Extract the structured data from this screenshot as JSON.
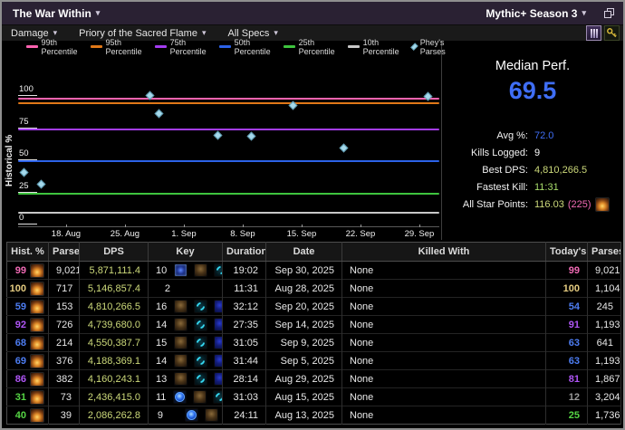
{
  "titlebar": {
    "expansion": "The War Within",
    "season": "Mythic+ Season 3",
    "caret": "▾"
  },
  "toolbar": {
    "metric": "Damage",
    "boss": "Priory of the Sacred Flame",
    "spec": "All Specs",
    "caret": "▾"
  },
  "icons": {
    "titlebar_window": "copy-window-icon",
    "boss_tile": "boss-icon",
    "key_tile": "key-icon",
    "parses_marker": "diamond-icon",
    "player_spec": "spec-icon"
  },
  "legend": [
    {
      "label": "99th Percentile",
      "color": "#ff63b0",
      "type": "line"
    },
    {
      "label": "95th Percentile",
      "color": "#e07818",
      "type": "line"
    },
    {
      "label": "75th Percentile",
      "color": "#a43cf0",
      "type": "line"
    },
    {
      "label": "50th Percentile",
      "color": "#2c62e8",
      "type": "line"
    },
    {
      "label": "25th Percentile",
      "color": "#3ec43e",
      "type": "line"
    },
    {
      "label": "10th Percentile",
      "color": "#c8c8c8",
      "type": "line"
    },
    {
      "label": "Phey's Parses",
      "color": "#a5d9eb",
      "type": "diamond"
    }
  ],
  "chart_data": {
    "type": "scatter",
    "title": "",
    "xlabel": "",
    "ylabel": "Historical %",
    "ylim": [
      0,
      130
    ],
    "grid": false,
    "yticks": [
      100,
      75,
      50,
      25,
      0
    ],
    "x_ticks": [
      {
        "label": "18. Aug",
        "day": 7
      },
      {
        "label": "25. Aug",
        "day": 14
      },
      {
        "label": "1. Sep",
        "day": 21
      },
      {
        "label": "8. Sep",
        "day": 28
      },
      {
        "label": "15. Sep",
        "day": 35
      },
      {
        "label": "22. Sep",
        "day": 42
      },
      {
        "label": "29. Sep",
        "day": 49
      }
    ],
    "percentile_lines": [
      {
        "name": "99th Percentile",
        "value": 99,
        "color": "#ff63b0"
      },
      {
        "name": "95th Percentile",
        "value": 95,
        "color": "#e07818"
      },
      {
        "name": "75th Percentile",
        "value": 75,
        "color": "#a43cf0"
      },
      {
        "name": "50th Percentile",
        "value": 50,
        "color": "#2c62e8"
      },
      {
        "name": "25th Percentile",
        "value": 25,
        "color": "#3ec43e"
      },
      {
        "name": "10th Percentile",
        "value": 10,
        "color": "#c8c8c8"
      }
    ],
    "series_name": "Phey's Parses",
    "point_color": "#a5d9eb",
    "points": [
      {
        "date": "Aug 13, 2025",
        "day": 2,
        "value": 40
      },
      {
        "date": "Aug 15, 2025",
        "day": 4,
        "value": 31
      },
      {
        "date": "Aug 28, 2025",
        "day": 17,
        "value": 100
      },
      {
        "date": "Aug 29, 2025",
        "day": 18,
        "value": 86
      },
      {
        "date": "Sep 5, 2025",
        "day": 25,
        "value": 69
      },
      {
        "date": "Sep 9, 2025",
        "day": 29,
        "value": 68
      },
      {
        "date": "Sep 14, 2025",
        "day": 34,
        "value": 92
      },
      {
        "date": "Sep 20, 2025",
        "day": 40,
        "value": 59
      },
      {
        "date": "Sep 30, 2025",
        "day": 50,
        "value": 99
      }
    ]
  },
  "summary": {
    "median_label": "Median Perf.",
    "median_value": "69.5",
    "median_color": "#3f6ef5",
    "stats": [
      {
        "label": "Avg %:",
        "value": "72.0",
        "color": "#3f6ef5"
      },
      {
        "label": "Kills Logged:",
        "value": "9",
        "color": "#ffffff"
      },
      {
        "label": "Best DPS:",
        "value": "4,810,266.5",
        "color": "#ccd97a"
      },
      {
        "label": "Fastest Kill:",
        "value": "11:31",
        "color": "#a8dd6b"
      },
      {
        "label": "All Star Points:",
        "value": "116.03",
        "color": "#ccd97a",
        "extra": "(225)",
        "extra_color": "#f06ab4",
        "icon": "spec-icon"
      }
    ]
  },
  "table": {
    "headers": [
      "Hist. %",
      "Parses",
      "DPS",
      "Key",
      "Duration",
      "Date",
      "Killed With",
      "Today's %",
      "Parses"
    ],
    "dps_color": "#ccd97a",
    "tier_colors": {
      "artifact": "#e5cc80",
      "astounding": "#f06ab4",
      "epic": "#af55f5",
      "rare": "#4d7df2",
      "uncommon": "#55d544",
      "common": "#9a9a9a"
    },
    "rows": [
      {
        "hist": "99",
        "hist_tier": "astounding",
        "parses": "9,021",
        "dps": "5,871,111.4",
        "key": "10",
        "affixes": [
          "ascendant",
          "devour",
          "swirl"
        ],
        "duration": "19:02",
        "date": "Sep 30, 2025",
        "killed_with": "None",
        "today": "99",
        "today_tier": "astounding",
        "today_parses": "9,021"
      },
      {
        "hist": "100",
        "hist_tier": "artifact",
        "parses": "717",
        "dps": "5,146,857.4",
        "key": "2",
        "affixes": [],
        "duration": "11:31",
        "date": "Aug 28, 2025",
        "killed_with": "None",
        "today": "100",
        "today_tier": "artifact",
        "today_parses": "1,104"
      },
      {
        "hist": "59",
        "hist_tier": "rare",
        "parses": "153",
        "dps": "4,810,266.5",
        "key": "16",
        "affixes": [
          "devour",
          "swirl",
          "voidbound"
        ],
        "duration": "32:12",
        "date": "Sep 20, 2025",
        "killed_with": "None",
        "today": "54",
        "today_tier": "rare",
        "today_parses": "245"
      },
      {
        "hist": "92",
        "hist_tier": "epic",
        "parses": "726",
        "dps": "4,739,680.0",
        "key": "14",
        "affixes": [
          "devour",
          "swirl",
          "voidbound"
        ],
        "duration": "27:35",
        "date": "Sep 14, 2025",
        "killed_with": "None",
        "today": "91",
        "today_tier": "epic",
        "today_parses": "1,193"
      },
      {
        "hist": "68",
        "hist_tier": "rare",
        "parses": "214",
        "dps": "4,550,387.7",
        "key": "15",
        "affixes": [
          "devour",
          "swirl",
          "voidbound"
        ],
        "duration": "31:05",
        "date": "Sep 9, 2025",
        "killed_with": "None",
        "today": "63",
        "today_tier": "rare",
        "today_parses": "641"
      },
      {
        "hist": "69",
        "hist_tier": "rare",
        "parses": "376",
        "dps": "4,188,369.1",
        "key": "14",
        "affixes": [
          "devour",
          "swirl",
          "voidbound"
        ],
        "duration": "31:44",
        "date": "Sep 5, 2025",
        "killed_with": "None",
        "today": "63",
        "today_tier": "rare",
        "today_parses": "1,193"
      },
      {
        "hist": "86",
        "hist_tier": "epic",
        "parses": "382",
        "dps": "4,160,243.1",
        "key": "13",
        "affixes": [
          "devour",
          "swirl",
          "voidbound"
        ],
        "duration": "28:14",
        "date": "Aug 29, 2025",
        "killed_with": "None",
        "today": "81",
        "today_tier": "epic",
        "today_parses": "1,867"
      },
      {
        "hist": "31",
        "hist_tier": "uncommon",
        "parses": "73",
        "dps": "2,436,415.0",
        "key": "11",
        "affixes": [
          "orb",
          "devour",
          "swirl"
        ],
        "duration": "31:03",
        "date": "Aug 15, 2025",
        "killed_with": "None",
        "today": "12",
        "today_tier": "common",
        "today_parses": "3,204"
      },
      {
        "hist": "40",
        "hist_tier": "uncommon",
        "parses": "39",
        "dps": "2,086,262.8",
        "key": "9",
        "affixes": [
          "blank",
          "orb",
          "devour"
        ],
        "duration": "24:11",
        "date": "Aug 13, 2025",
        "killed_with": "None",
        "today": "25",
        "today_tier": "uncommon",
        "today_parses": "1,736"
      }
    ]
  }
}
